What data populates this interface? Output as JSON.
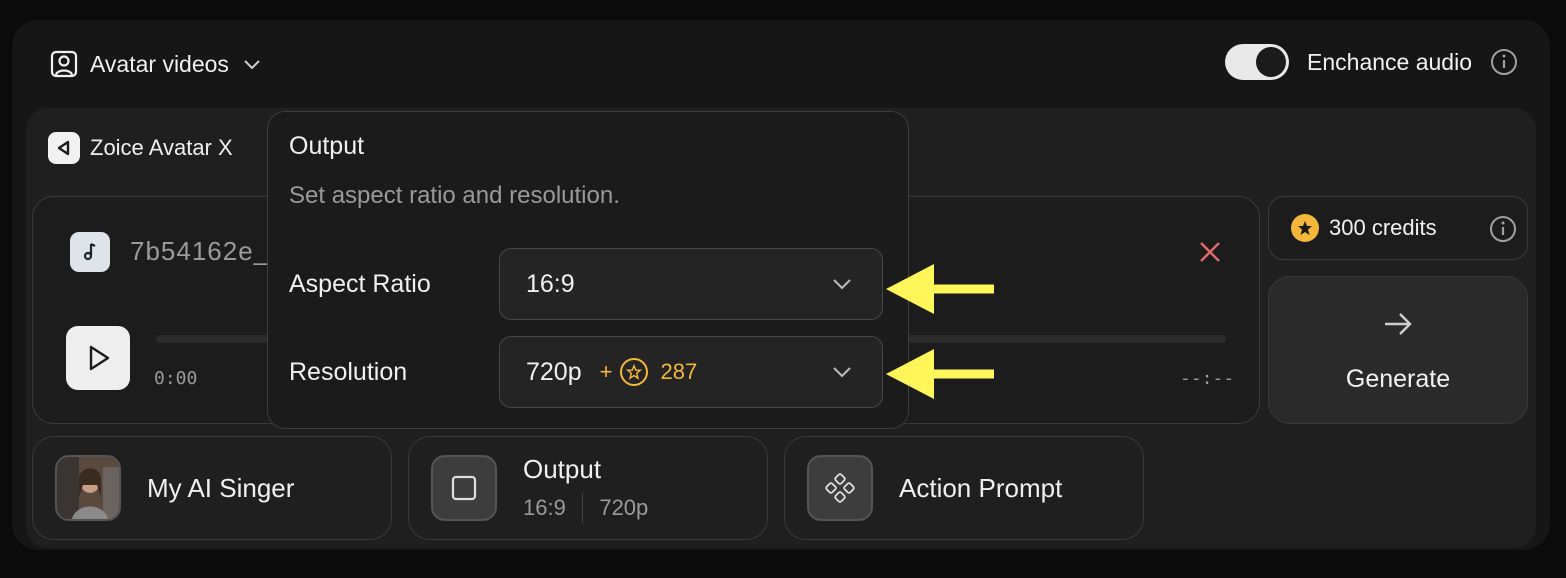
{
  "header": {
    "mode_label": "Avatar videos",
    "enhance_label": "Enchance audio",
    "enhance_on": true
  },
  "model": {
    "name": "Zoice Avatar X"
  },
  "audio": {
    "filename": "7b54162e_",
    "time_start": "0:00",
    "time_end": "--:--"
  },
  "credits": {
    "label": "300 credits"
  },
  "generate": {
    "label": "Generate"
  },
  "chips": {
    "singer": {
      "label": "My AI Singer"
    },
    "output": {
      "label": "Output",
      "aspect": "16:9",
      "resolution": "720p"
    },
    "action": {
      "label": "Action Prompt"
    }
  },
  "popover": {
    "title": "Output",
    "subtitle": "Set aspect ratio and resolution.",
    "aspect_label": "Aspect Ratio",
    "aspect_value": "16:9",
    "resolution_label": "Resolution",
    "resolution_value": "720p",
    "resolution_plus": "+",
    "resolution_cost": "287"
  },
  "colors": {
    "accent_gold": "#f4b73a",
    "annotation_arrow": "#fff75a",
    "close_red": "#e46a6a"
  }
}
